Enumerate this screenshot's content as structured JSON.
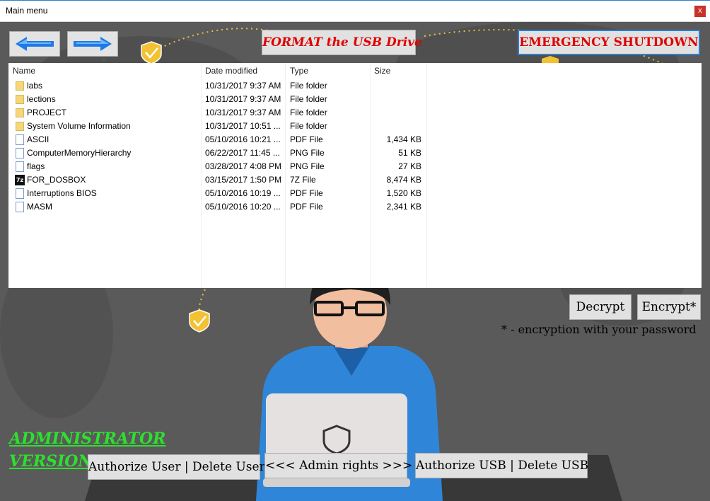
{
  "window": {
    "title": "Main menu",
    "close_label": "x"
  },
  "toolbar": {
    "back_icon": "arrow-left-icon",
    "forward_icon": "arrow-right-icon",
    "format_label": "FORMAT the USB Drive",
    "emergency_label": "EMERGENCY SHUTDOWN"
  },
  "explorer": {
    "columns": {
      "name": "Name",
      "date": "Date modified",
      "type": "Type",
      "size": "Size"
    },
    "rows": [
      {
        "name": "labs",
        "date": "10/31/2017 9:37 AM",
        "type": "File folder",
        "size": "",
        "icon": "folder-icon"
      },
      {
        "name": "lections",
        "date": "10/31/2017 9:37 AM",
        "type": "File folder",
        "size": "",
        "icon": "folder-icon"
      },
      {
        "name": "PROJECT",
        "date": "10/31/2017 9:37 AM",
        "type": "File folder",
        "size": "",
        "icon": "folder-icon"
      },
      {
        "name": "System Volume Information",
        "date": "10/31/2017 10:51 ...",
        "type": "File folder",
        "size": "",
        "icon": "folder-icon"
      },
      {
        "name": "ASCII",
        "date": "05/10/2016 10:21 ...",
        "type": "PDF File",
        "size": "1,434 KB",
        "icon": "pdf-file-icon"
      },
      {
        "name": "ComputerMemoryHierarchy",
        "date": "06/22/2017 11:45 ...",
        "type": "PNG File",
        "size": "51 KB",
        "icon": "png-file-icon"
      },
      {
        "name": "flags",
        "date": "03/28/2017 4:08 PM",
        "type": "PNG File",
        "size": "27 KB",
        "icon": "png-file-icon"
      },
      {
        "name": "FOR_DOSBOX",
        "date": "03/15/2017 1:50 PM",
        "type": "7Z File",
        "size": "8,474 KB",
        "icon": "7z-file-icon"
      },
      {
        "name": "Interruptions BIOS",
        "date": "05/10/2016 10:19 ...",
        "type": "PDF File",
        "size": "1,520 KB",
        "icon": "pdf-file-icon"
      },
      {
        "name": "MASM",
        "date": "05/10/2016 10:20 ...",
        "type": "PDF File",
        "size": "2,341 KB",
        "icon": "pdf-file-icon"
      }
    ]
  },
  "actions": {
    "decrypt_label": "Decrypt",
    "encrypt_label": "Encrypt*",
    "encryption_note": "* - encryption with your password",
    "authorize_user_label": "Authorize User | Delete User",
    "admin_rights_label": "<<< Admin rights >>>",
    "authorize_usb_label": "Authorize USB | Delete USB"
  },
  "version": {
    "line1": "ADMINISTRATOR ",
    "line2": "VERSION"
  },
  "colors": {
    "accent_red": "#e00000",
    "admin_green": "#2ee02e",
    "arrow_blue": "#1e7be6",
    "shirt_blue": "#2f86d8"
  }
}
